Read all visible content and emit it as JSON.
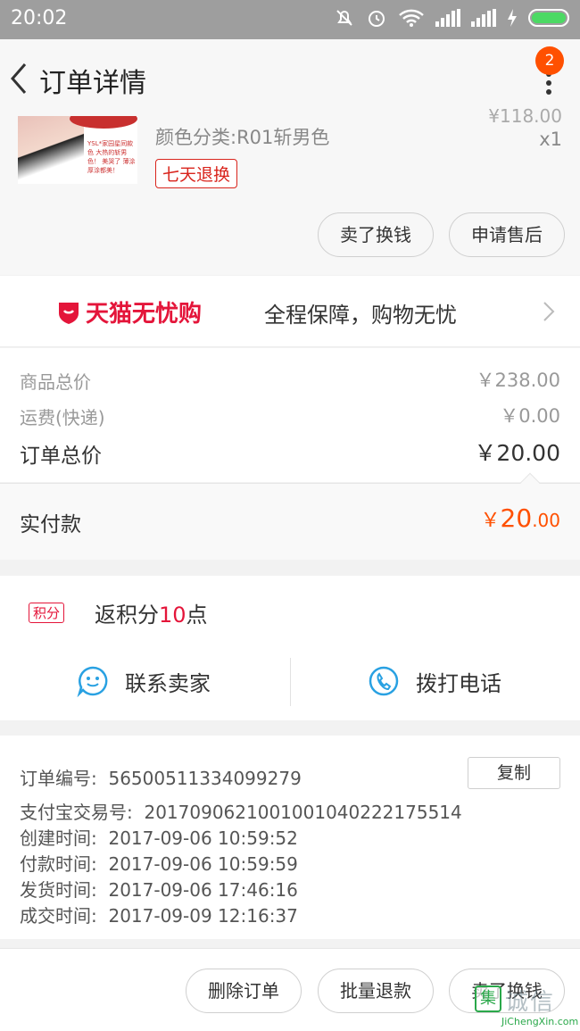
{
  "status_bar": {
    "time": "20:02"
  },
  "header": {
    "title": "订单详情",
    "badge_count": "2"
  },
  "product": {
    "sku": "颜色分类:R01斩男色",
    "quantity": "x1",
    "price_partial": "¥118.00",
    "return_tag": "七天退换",
    "thumb_text": "YSL*家园星同款色 大热的斩男色！ 美哭了 薄涂厚涂都美！",
    "sell_button": "卖了换钱",
    "after_sale_button": "申请售后"
  },
  "guarantee": {
    "brand": "天猫无忧购",
    "slogan": "全程保障，购物无忧"
  },
  "totals": {
    "goods_label": "商品总价",
    "goods_value": "￥238.00",
    "shipping_label": "运费(快递)",
    "shipping_value": "￥0.00",
    "order_label": "订单总价",
    "order_value": "￥20.00"
  },
  "paid": {
    "label": "实付款",
    "currency": "￥",
    "integer": "20",
    "decimal": ".00"
  },
  "points": {
    "tag": "积分",
    "prefix": "返积分",
    "amount": "10",
    "suffix": "点"
  },
  "contact": {
    "seller": "联系卖家",
    "call": "拨打电话"
  },
  "order_info": {
    "order_no_label": "订单编号:",
    "order_no": "56500511334099279",
    "copy_button": "复制",
    "alipay_label": "支付宝交易号:",
    "alipay_no": "2017090621001001040222175514",
    "created_label": "创建时间:",
    "created": "2017-09-06 10:59:52",
    "paid_label": "付款时间:",
    "paid_time": "2017-09-06 10:59:59",
    "shipped_label": "发货时间:",
    "shipped": "2017-09-06 17:46:16",
    "closed_label": "成交时间:",
    "closed": "2017-09-09 12:16:37"
  },
  "footer": {
    "delete": "删除订单",
    "batch_refund": "批量退款",
    "sell": "卖了换钱"
  },
  "watermark": {
    "logo_char": "集",
    "cn": "诚信",
    "en": "JiChengXin.com"
  }
}
